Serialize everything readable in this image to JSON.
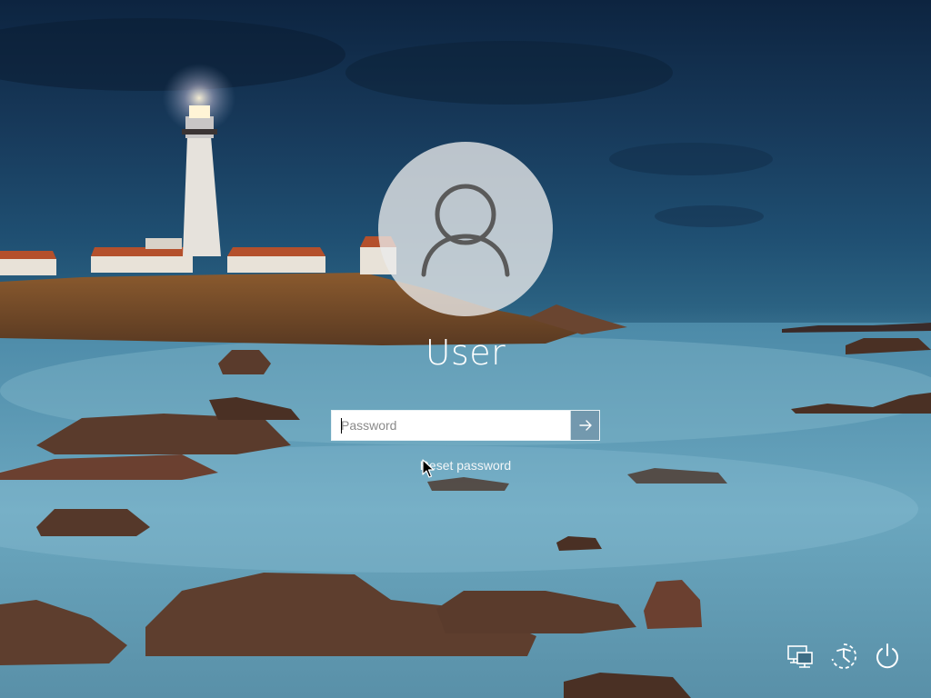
{
  "user": {
    "name": "User"
  },
  "password": {
    "placeholder": "Password",
    "value": ""
  },
  "links": {
    "reset_password": "Reset password"
  },
  "icons": {
    "avatar": "user-icon",
    "submit": "arrow-right-icon",
    "network": "network-icon",
    "ease_of_access": "ease-of-access-icon",
    "power": "power-icon"
  },
  "colors": {
    "avatar_bg": "#ebebeb",
    "icon_stroke": "#ffffff"
  }
}
